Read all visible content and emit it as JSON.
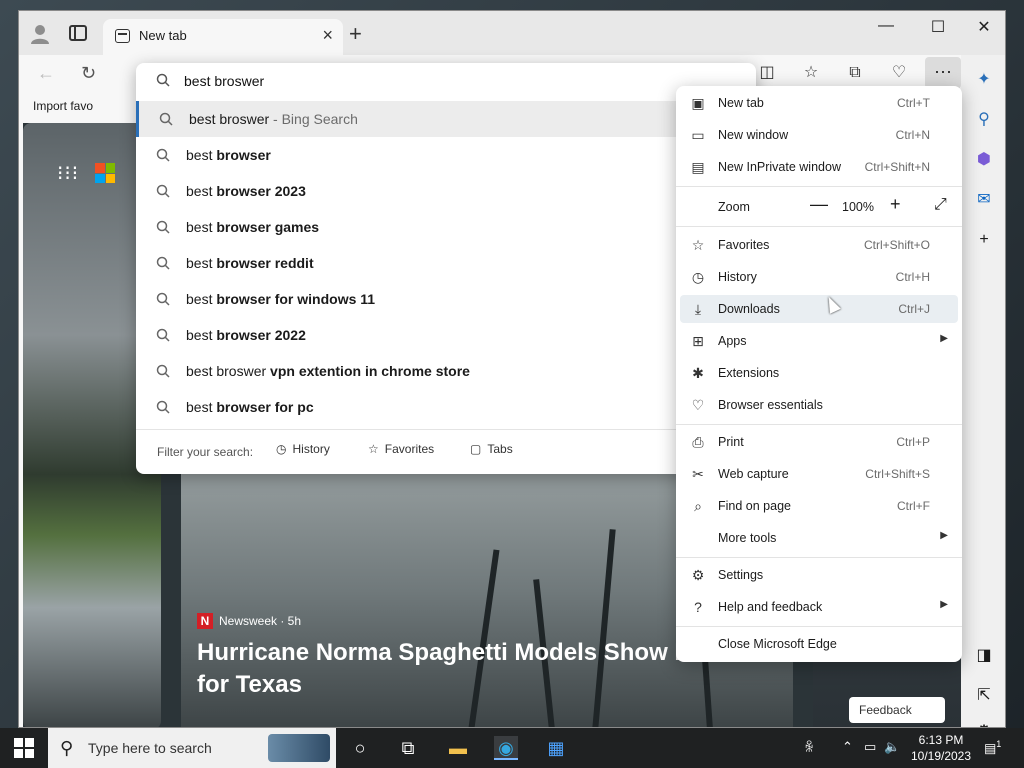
{
  "browser": {
    "tab_title": "New tab",
    "favorites_bar_item": "Import favo"
  },
  "address": {
    "query": "best broswer"
  },
  "suggestions": [
    {
      "plain": "best broswer",
      "bold": "",
      "suffix": " - Bing Search"
    },
    {
      "plain": "best ",
      "bold": "browser",
      "suffix": ""
    },
    {
      "plain": "best ",
      "bold": "browser 2023",
      "suffix": ""
    },
    {
      "plain": "best ",
      "bold": "browser games",
      "suffix": ""
    },
    {
      "plain": "best ",
      "bold": "browser reddit",
      "suffix": ""
    },
    {
      "plain": "best ",
      "bold": "browser for windows 11",
      "suffix": ""
    },
    {
      "plain": "best ",
      "bold": "browser 2022",
      "suffix": ""
    },
    {
      "plain": "best broswer ",
      "bold": "vpn extention in chrome store",
      "suffix": ""
    },
    {
      "plain": "best ",
      "bold": "browser for pc",
      "suffix": ""
    }
  ],
  "filter": {
    "label": "Filter your search:",
    "history": "History",
    "favorites": "Favorites",
    "tabs": "Tabs"
  },
  "menu": {
    "new_tab": {
      "label": "New tab",
      "shortcut": "Ctrl+T"
    },
    "new_window": {
      "label": "New window",
      "shortcut": "Ctrl+N"
    },
    "new_inprivate": {
      "label": "New InPrivate window",
      "shortcut": "Ctrl+Shift+N"
    },
    "zoom": {
      "label": "Zoom",
      "value": "100%"
    },
    "favorites": {
      "label": "Favorites",
      "shortcut": "Ctrl+Shift+O"
    },
    "history": {
      "label": "History",
      "shortcut": "Ctrl+H"
    },
    "downloads": {
      "label": "Downloads",
      "shortcut": "Ctrl+J"
    },
    "apps": {
      "label": "Apps"
    },
    "extensions": {
      "label": "Extensions"
    },
    "browser_essentials": {
      "label": "Browser essentials"
    },
    "print": {
      "label": "Print",
      "shortcut": "Ctrl+P"
    },
    "web_capture": {
      "label": "Web capture",
      "shortcut": "Ctrl+Shift+S"
    },
    "find_on_page": {
      "label": "Find on page",
      "shortcut": "Ctrl+F"
    },
    "more_tools": {
      "label": "More tools"
    },
    "settings": {
      "label": "Settings"
    },
    "help": {
      "label": "Help and feedback"
    },
    "close": {
      "label": "Close Microsoft Edge"
    }
  },
  "news": {
    "source": "Newsweek · 5h",
    "headline": "Hurricane Norma Spaghetti Models Show Path for Texas"
  },
  "feedback_label": "Feedback",
  "taskbar": {
    "search_placeholder": "Type here to search",
    "time": "6:13 PM",
    "date": "10/19/2023",
    "notification_count": "1"
  },
  "colors": {
    "accent": "#2a6fb8",
    "menu_hover": "#e9eef2"
  }
}
